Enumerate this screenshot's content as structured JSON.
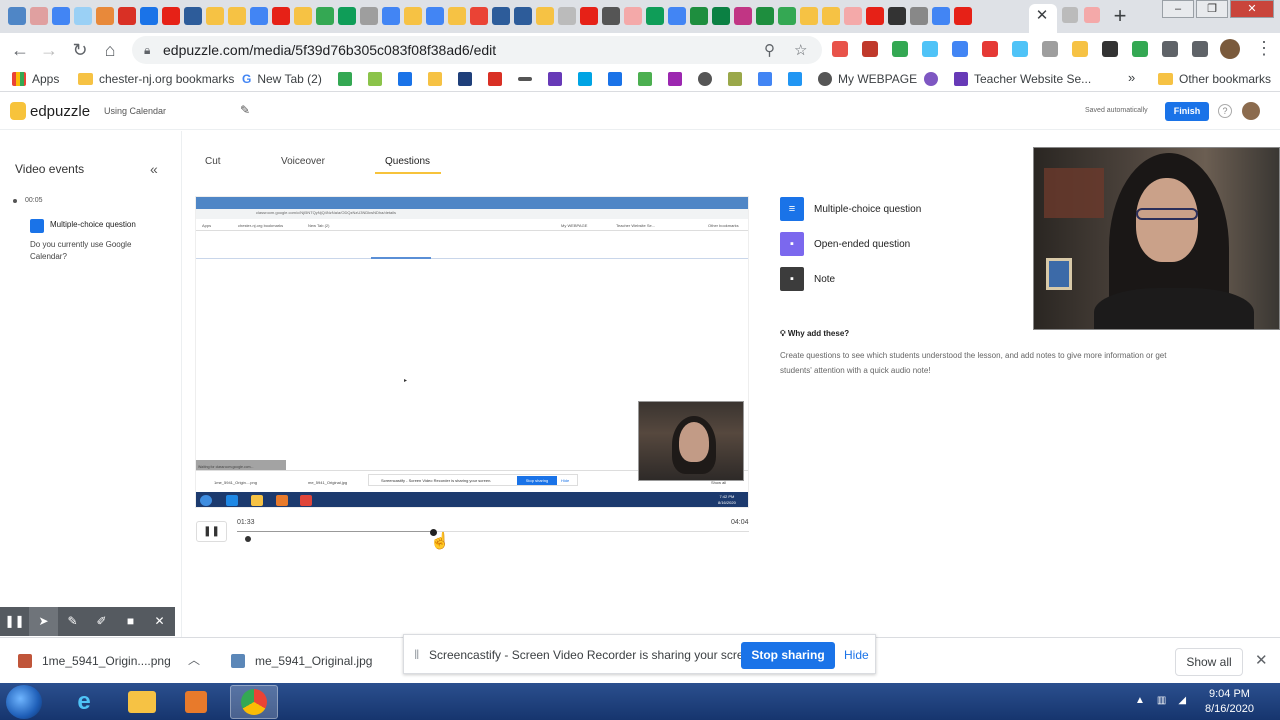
{
  "browser": {
    "url": "edpuzzle.com/media/5f39d76b305c083f08f38ad6/edit",
    "bookmarks": [
      {
        "label": "Apps",
        "icon": "apps-icon"
      },
      {
        "label": "chester-nj.org bookmarks",
        "icon": "folder-icon"
      },
      {
        "label": "New Tab (2)",
        "icon": "google-icon"
      },
      {
        "label": "My WEBPAGE",
        "icon": "globe-icon"
      },
      {
        "label": "Teacher Website Se...",
        "icon": "forms-icon"
      },
      {
        "label": "Other bookmarks",
        "icon": "folder-icon"
      }
    ],
    "window_controls": {
      "minimize": "–",
      "maximize": "❐",
      "close": "✕"
    }
  },
  "edpuzzle": {
    "brand": "edpuzzle",
    "doc_title": "Using Calendar",
    "saved_status": "Saved automatically",
    "finish_label": "Finish",
    "help_label": "?"
  },
  "left_panel": {
    "title": "Video events",
    "event": {
      "time": "00:05",
      "type": "Multiple-choice question",
      "question": "Do you currently use Google Calendar?"
    }
  },
  "tabs": [
    {
      "label": "Cut",
      "active": false
    },
    {
      "label": "Voiceover",
      "active": false
    },
    {
      "label": "Questions",
      "active": true
    }
  ],
  "video": {
    "inner_url": "classroom.google.com/c/NjI5NTQyNjQ4NzNa/a/ODQzNzU3NDkwNDha/details",
    "inner_bookmarks": [
      "Apps",
      "chester-nj.org bookmarks",
      "New Tab (2)",
      "My WEBPAGE",
      "Teacher Website Se...",
      "Other bookmarks"
    ],
    "inner_status": "Waiting for classroom.google.com...",
    "inner_downloads": [
      "1me_5941_Origin....png",
      "me_5941_Original.jpg"
    ],
    "inner_share_text": "Screencastify - Screen Video Recorder is sharing your screen.",
    "inner_stop": "Stop sharing",
    "inner_hide": "Hide",
    "inner_show_all": "Show all",
    "inner_time": "7:42 PM",
    "inner_date": "8/16/2020"
  },
  "player": {
    "current_time": "01:33",
    "total_time": "04:04",
    "progress": 0.38,
    "pause_label": "❚❚"
  },
  "question_types": [
    {
      "label": "Multiple-choice question",
      "icon": "list-icon",
      "color": "#1a73e8"
    },
    {
      "label": "Open-ended question",
      "icon": "chat-icon",
      "color": "#7b68ee"
    },
    {
      "label": "Note",
      "icon": "note-icon",
      "color": "#3c3c3c"
    }
  ],
  "why": {
    "title": "Why add these?",
    "text": "Create questions to see which students understood the lesson, and add notes to give more information or get students' attention with a quick audio note!"
  },
  "screencastify_toolbar": [
    "pause-icon",
    "pointer-icon",
    "pen-icon",
    "highlighter-icon",
    "camera-icon",
    "close-icon"
  ],
  "download_bar": {
    "items": [
      {
        "label": "1me_5941_Origin....png"
      },
      {
        "label": "me_5941_Original.jpg"
      }
    ],
    "show_all": "Show all"
  },
  "share_banner": {
    "text": "Screencastify - Screen Video Recorder is sharing your screen.",
    "stop_label": "Stop sharing",
    "hide_label": "Hide"
  },
  "taskbar": {
    "time": "9:04 PM",
    "date": "8/16/2020"
  }
}
